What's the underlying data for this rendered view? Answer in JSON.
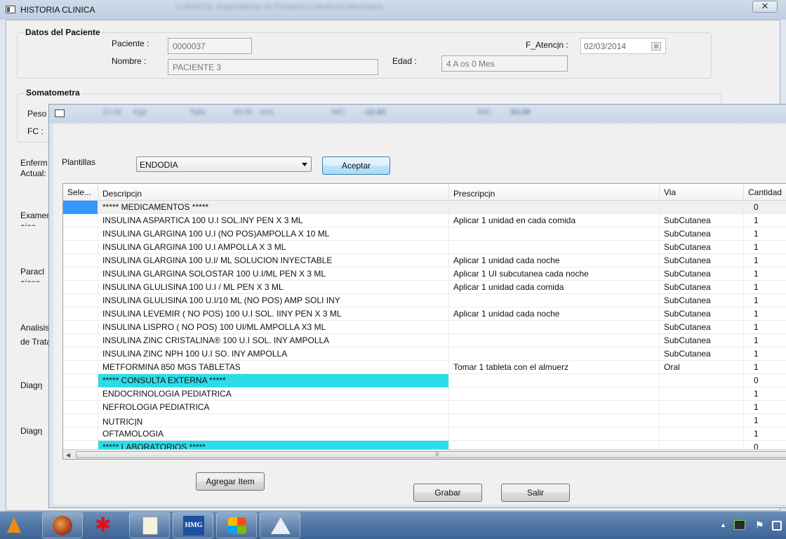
{
  "main_window": {
    "title": "HISTORIA CLINICA",
    "title_blurred": "CURARTE: Especialistas en Pediatría y Medicina Alternativa",
    "close_label": "✕"
  },
  "patient": {
    "group_title": "Datos del Paciente",
    "paciente_label": "Paciente :",
    "paciente_value": "0000037",
    "nombre_label": "Nombre  :",
    "nombre_value": "PACIENTE 3",
    "edad_label": "Edad :",
    "edad_value": "4 A    os 0 Mes",
    "fecha_label": "F_Atenciฺn :",
    "fecha_value": "02/03/2014"
  },
  "somatometria": {
    "group_title": "Somatometra",
    "peso_label": "Peso",
    "fc_label": "FC :"
  },
  "left_labels": {
    "enfermedad": "Enferm",
    "actual": "Actual:",
    "examen": "Examen",
    "examen2": "ajco",
    "paraclinicos": "Paracl",
    "paraclinicos2": "ajcos",
    "analisis": "Analisis",
    "tratamiento": "de Trata",
    "diagnostico1": "Diagnฺ",
    "diagnostico2": "Diagnฺ"
  },
  "dialog": {
    "blurred_values": [
      "22.00",
      "Kgs",
      "Talla",
      "49.00",
      "cms",
      "IMC",
      "-12.83",
      "IMC",
      "83.38"
    ],
    "plantillas_label": "Plantillas",
    "plantilla_selected": "ENDODIA",
    "aceptar_label": "Aceptar",
    "agregar_label": "Agregar Item",
    "grabar_label": "Grabar",
    "salir_label": "Salir"
  },
  "table": {
    "headers": [
      "Sele...",
      "Descripciฺn",
      "Prescripciฺn",
      "Via",
      "Cantidad"
    ],
    "rows": [
      {
        "sel": "",
        "desc": "*****  MEDICAMENTOS  *****",
        "presc": "",
        "via": "",
        "cant": "0"
      },
      {
        "sel": "",
        "desc": "INSULINA ASPARTICA 100 U.I SOL.INY PEN X 3 ML",
        "presc": "Aplicar 1 unidad en cada comida",
        "via": "SubCutanea",
        "cant": "1"
      },
      {
        "sel": "",
        "desc": "INSULINA GLARGINA 100 U.I (NO POS)AMPOLLA X 10 ML",
        "presc": "",
        "via": "SubCutanea",
        "cant": "1"
      },
      {
        "sel": "",
        "desc": "INSULINA GLARGINA 100 U.I AMPOLLA X 3 ML",
        "presc": "",
        "via": "SubCutanea",
        "cant": "1"
      },
      {
        "sel": "",
        "desc": "INSULINA GLARGINA 100 U.I/ ML SOLUCION INYECTABLE",
        "presc": "Aplicar 1 unidad cada noche",
        "via": "SubCutanea",
        "cant": "1"
      },
      {
        "sel": "",
        "desc": "INSULINA GLARGINA SOLOSTAR 100 U.I/ML PEN X 3 ML",
        "presc": "Aplicar 1 UI subcutanea cada noche",
        "via": "SubCutanea",
        "cant": "1"
      },
      {
        "sel": "",
        "desc": "INSULINA GLULISINA 100 U.I / ML PEN X 3 ML",
        "presc": "Aplicar 1 unidad cada comida",
        "via": "SubCutanea",
        "cant": "1"
      },
      {
        "sel": "",
        "desc": "INSULINA GLULISINA 100 U.I/10 ML (NO POS) AMP SOLI INY",
        "presc": "",
        "via": "SubCutanea",
        "cant": "1"
      },
      {
        "sel": "",
        "desc": "INSULINA LEVEMIR ( NO POS) 100 U.I SOL. IINY PEN X 3 ML",
        "presc": "Aplicar 1 unidad cada noche",
        "via": "SubCutanea",
        "cant": "1"
      },
      {
        "sel": "",
        "desc": "INSULINA LISPRO ( NO POS) 100 UI/ML AMPOLLA X3 ML",
        "presc": "",
        "via": "SubCutanea",
        "cant": "1"
      },
      {
        "sel": "",
        "desc": "INSULINA ZINC  CRISTALINA® 100 U.I SOL. INY AMPOLLA",
        "presc": "",
        "via": "SubCutanea",
        "cant": "1"
      },
      {
        "sel": "",
        "desc": "INSULINA ZINC NPH 100 U.I SO. INY AMPOLLA",
        "presc": "",
        "via": "SubCutanea",
        "cant": "1"
      },
      {
        "sel": "",
        "desc": "METFORMINA 850 MGS TABLETAS",
        "presc": "Tomar 1 tableta con el almuerz",
        "via": "Oral",
        "cant": "1"
      },
      {
        "sel": "",
        "desc": "*****  CONSULTA EXTERNA  *****",
        "presc": "",
        "via": "",
        "cant": "0"
      },
      {
        "sel": "",
        "desc": "ENDOCRINOLOGIA PEDIATRICA",
        "presc": "",
        "via": "",
        "cant": "1"
      },
      {
        "sel": "",
        "desc": "NEFROLOGIA PEDIATRICA",
        "presc": "",
        "via": "",
        "cant": "1"
      },
      {
        "sel": "",
        "desc": "NUTRICIฺN",
        "presc": "",
        "via": "",
        "cant": "1"
      },
      {
        "sel": "",
        "desc": "OFTAMOLOGIA",
        "presc": "",
        "via": "",
        "cant": "1"
      },
      {
        "sel": "",
        "desc": "*****  LABORATORIOS  *****",
        "presc": "",
        "via": "",
        "cant": "0"
      }
    ],
    "scroll_grip": "|||"
  },
  "taskbar": {
    "apps": [
      "vlc-icon",
      "firefox-icon",
      "paint-splash-icon",
      "search-document-icon",
      "hmg-app-icon",
      "windows-logo-icon",
      "pyramid-app-icon"
    ],
    "hmg_label": "HMG"
  },
  "colors": {
    "row_selection": "#3399ff",
    "section_highlight": "#2ddce9"
  }
}
